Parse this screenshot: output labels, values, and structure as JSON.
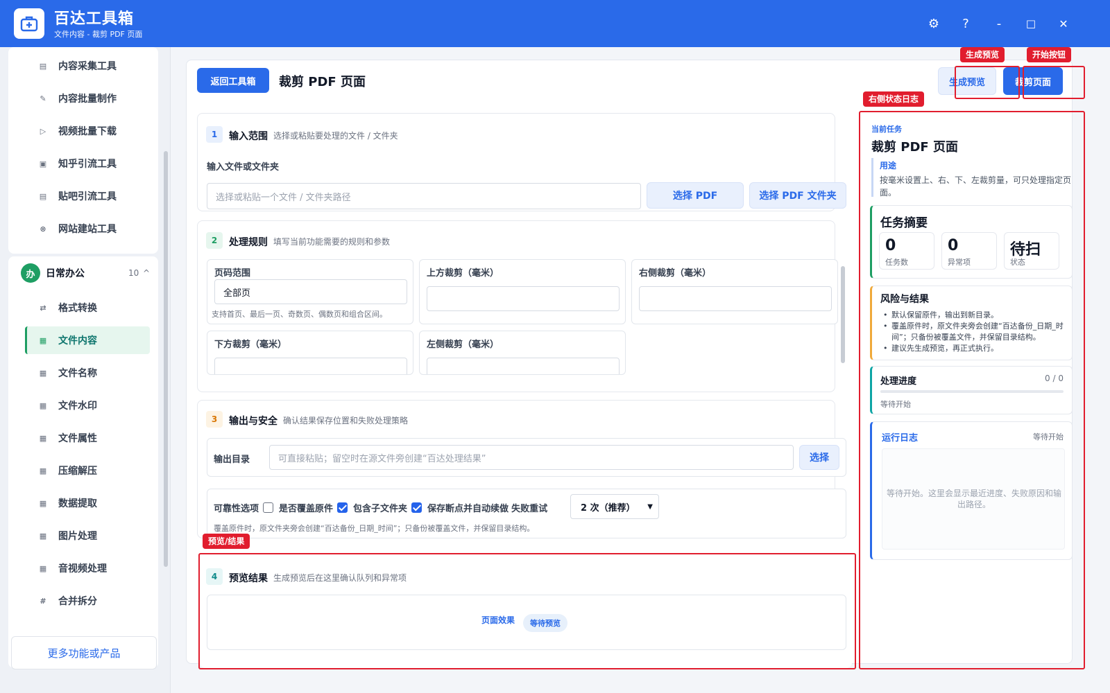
{
  "app": {
    "title": "百达工具箱",
    "subtitle": "文件内容 - 裁剪 PDF 页面"
  },
  "window_controls": {
    "settings": "⚙",
    "help": "?",
    "minimize": "-",
    "maximize": "□",
    "close": "✕"
  },
  "sidebar": {
    "top_items": [
      {
        "label": "内容采集工具",
        "icon": "document-icon"
      },
      {
        "label": "内容批量制作",
        "icon": "pen-icon"
      },
      {
        "label": "视频批量下载",
        "icon": "video-icon"
      },
      {
        "label": "知乎引流工具",
        "icon": "zhihu-icon"
      },
      {
        "label": "贴吧引流工具",
        "icon": "tieba-icon"
      },
      {
        "label": "网站建站工具",
        "icon": "globe-icon"
      }
    ],
    "group": {
      "badge": "办",
      "name": "日常办公",
      "count": "10",
      "chevron": "^"
    },
    "group_items": [
      {
        "label": "格式转换",
        "icon": "swap-icon"
      },
      {
        "label": "文件内容",
        "icon": "grid-icon"
      },
      {
        "label": "文件名称",
        "icon": "grid-icon"
      },
      {
        "label": "文件水印",
        "icon": "grid-icon"
      },
      {
        "label": "文件属性",
        "icon": "grid-icon"
      },
      {
        "label": "压缩解压",
        "icon": "grid-icon"
      },
      {
        "label": "数据提取",
        "icon": "grid-icon"
      },
      {
        "label": "图片处理",
        "icon": "grid-icon"
      },
      {
        "label": "音视频处理",
        "icon": "grid-icon"
      },
      {
        "label": "合并拆分",
        "icon": "hash-icon"
      }
    ],
    "more": "更多功能或产品"
  },
  "header": {
    "back": "返回工具箱",
    "title": "裁剪 PDF 页面",
    "preview_btn": "生成预览",
    "start_btn": "裁剪页面"
  },
  "annotations": {
    "preview": "生成预览",
    "start": "开始按钮",
    "log": "右侧状态日志",
    "result": "预览/结果"
  },
  "step1": {
    "num": "1",
    "title": "输入范围",
    "desc": "选择或粘贴要处理的文件 / 文件夹",
    "field_label": "输入文件或文件夹",
    "placeholder": "选择或粘贴一个文件 / 文件夹路径",
    "btn_pdf": "选择 PDF",
    "btn_folder": "选择 PDF 文件夹"
  },
  "step2": {
    "num": "2",
    "title": "处理规则",
    "desc": "填写当前功能需要的规则和参数",
    "page_range": {
      "label": "页码范围",
      "value": "全部页",
      "hint": "支持首页、最后一页、奇数页、偶数页和组合区间。"
    },
    "top": {
      "label": "上方裁剪（毫米）",
      "value": ""
    },
    "right": {
      "label": "右侧裁剪（毫米）",
      "value": ""
    },
    "bottom": {
      "label": "下方裁剪（毫米）",
      "value": ""
    },
    "left": {
      "label": "左侧裁剪（毫米）",
      "value": ""
    }
  },
  "step3": {
    "num": "3",
    "title": "输出与安全",
    "desc": "确认结果保存位置和失败处理策略",
    "out_label": "输出目录",
    "out_placeholder": "可直接粘贴；留空时在源文件旁创建“百达处理结果”",
    "out_btn": "选择",
    "reliability_label": "可靠性选项",
    "overwrite": {
      "label": "是否覆盖原件",
      "checked": false
    },
    "subfolder": {
      "label": "包含子文件夹",
      "checked": true
    },
    "resume": {
      "label": "保存断点并自动续做",
      "checked": true
    },
    "retry_label": "失败重试",
    "retry_value": "2 次（推荐）",
    "note": "覆盖原件时，原文件夹旁会创建“百达备份_日期_时间”；只备份被覆盖文件，并保留目录结构。"
  },
  "step4": {
    "num": "4",
    "title": "预览结果",
    "desc": "生成预览后在这里确认队列和异常项",
    "effect": "页面效果",
    "status": "等待预览"
  },
  "right_panel": {
    "current_label": "当前任务",
    "current_title": "裁剪 PDF 页面",
    "usage_label": "用途",
    "usage_text": "按毫米设置上、右、下、左裁剪量，可只处理指定页面。",
    "summary_title": "任务摘要",
    "stats": [
      {
        "value": "0",
        "label": "任务数"
      },
      {
        "value": "0",
        "label": "异常项"
      },
      {
        "value": "待扫",
        "label": "状态"
      }
    ],
    "risk_title": "风险与结果",
    "risk_items": [
      "默认保留原件，输出到新目录。",
      "覆盖原件时，原文件夹旁会创建“百达备份_日期_时间”；只备份被覆盖文件，并保留目录结构。",
      "建议先生成预览，再正式执行。"
    ],
    "progress_title": "处理进度",
    "progress_count": "0 / 0",
    "progress_status": "等待开始",
    "progress": 0,
    "log_title": "运行日志",
    "log_status": "等待开始",
    "log_text": "等待开始。这里会显示最近进度、失败原因和输出路径。"
  },
  "colors": {
    "primary": "#2a6ae9",
    "green": "#1e9e63",
    "annotation_red": "#e11d2e"
  }
}
